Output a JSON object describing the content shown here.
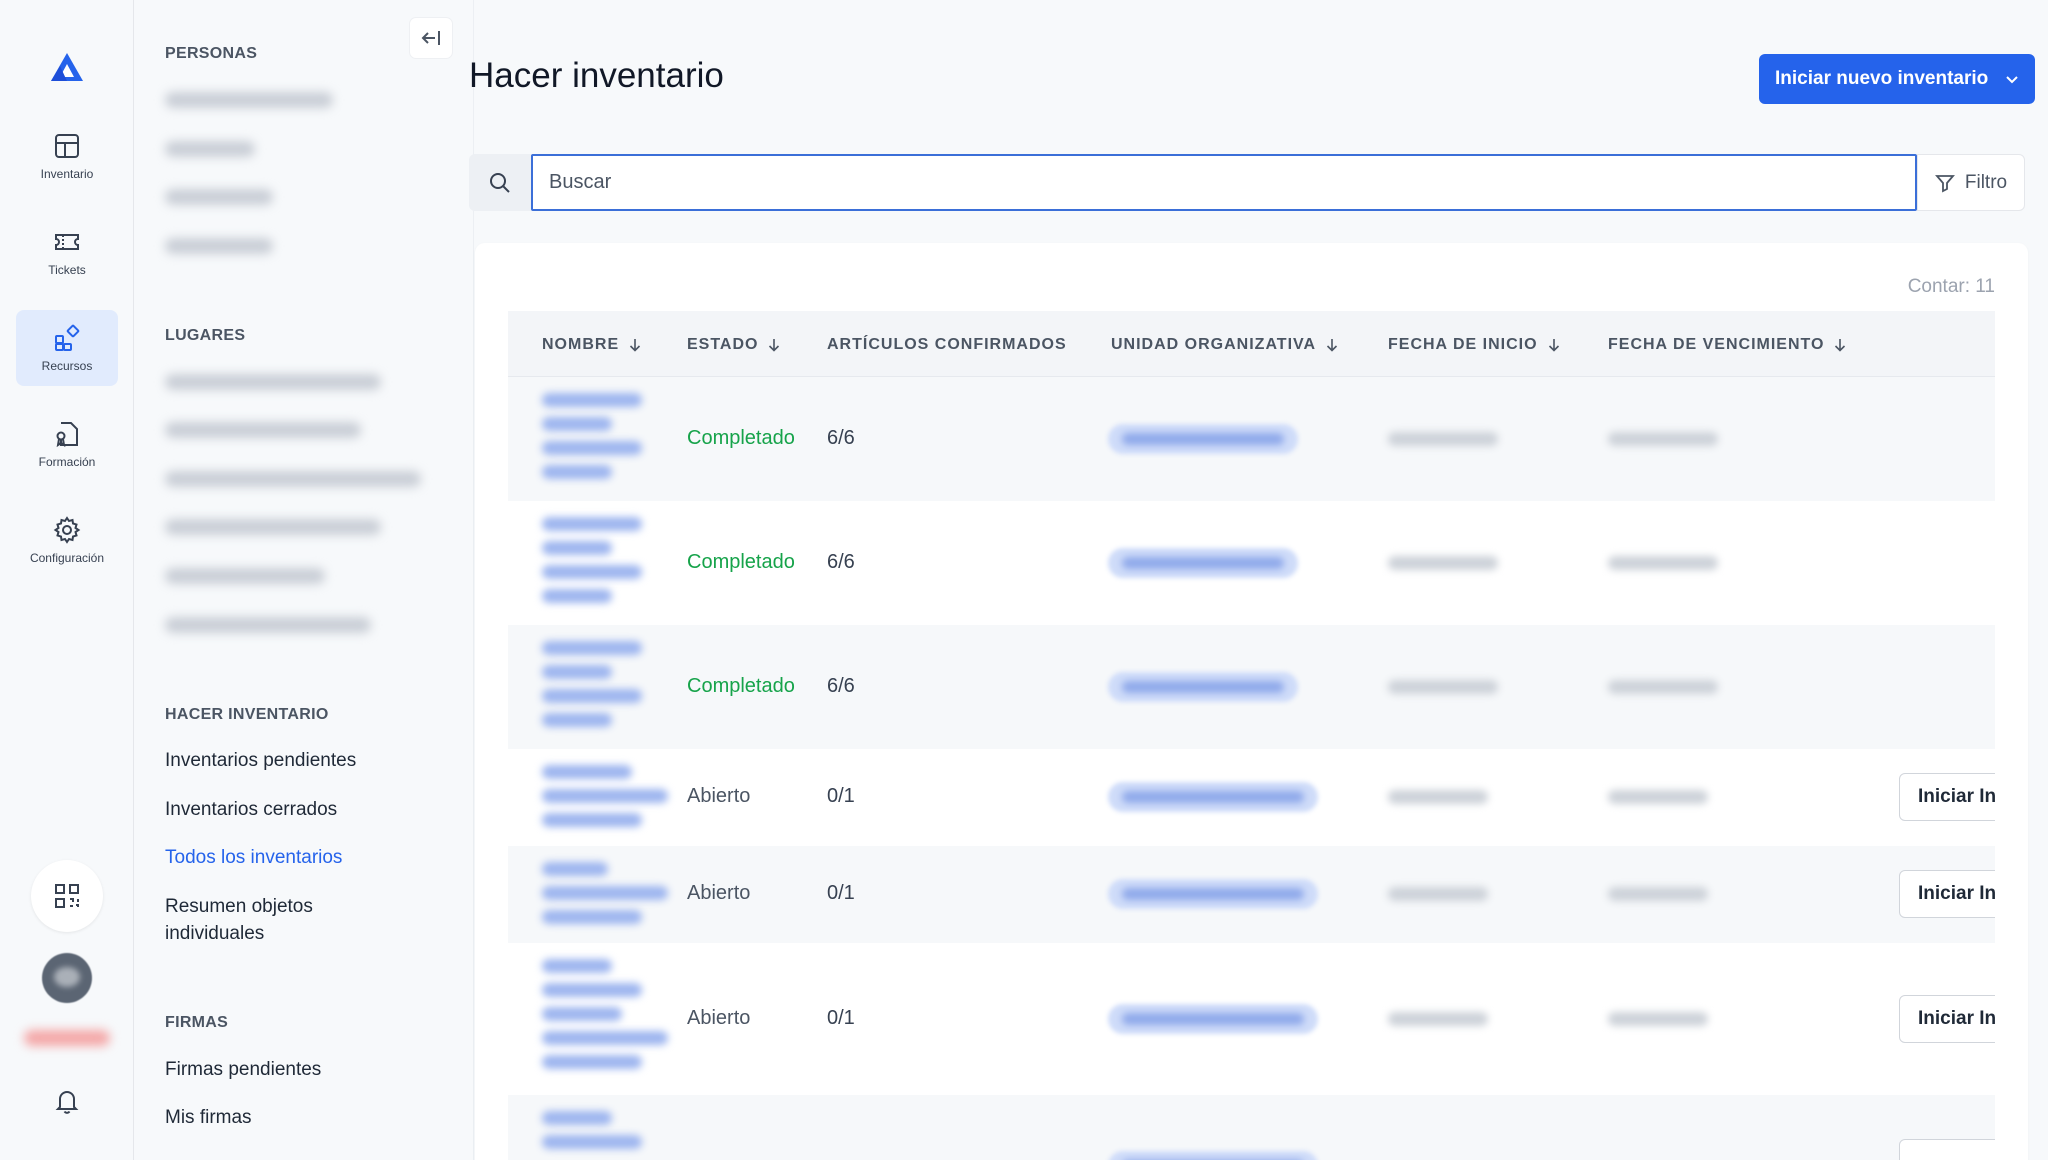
{
  "rail": {
    "items": [
      {
        "label": "Inventario",
        "icon": "table-grid-icon"
      },
      {
        "label": "Tickets",
        "icon": "ticket-icon"
      },
      {
        "label": "Recursos",
        "icon": "apps-icon",
        "active": true
      },
      {
        "label": "Formación",
        "icon": "certificate-icon"
      },
      {
        "label": "Configuración",
        "icon": "gear-icon"
      }
    ]
  },
  "sidebar": {
    "sections": {
      "personas": "PERSONAS",
      "lugares": "LUGARES",
      "hacer_inventario": "HACER INVENTARIO",
      "firmas": "FIRMAS"
    },
    "inventory_items": [
      "Inventarios pendientes",
      "Inventarios cerrados",
      "Todos los inventarios",
      "Resumen objetos",
      "individuales"
    ],
    "firmas_items": [
      "Firmas pendientes",
      "Mis firmas"
    ]
  },
  "header": {
    "title": "Hacer inventario",
    "new_button": "Iniciar nuevo inventario"
  },
  "search": {
    "placeholder": "Buscar",
    "filter_label": "Filtro"
  },
  "table": {
    "count_label": "Contar: 11",
    "columns": [
      "NOMBRE",
      "ESTADO",
      "ARTÍCULOS CONFIRMADOS",
      "UNIDAD ORGANIZATIVA",
      "FECHA DE INICIO",
      "FECHA DE VENCIMIENTO"
    ],
    "rows": [
      {
        "estado": "Completado",
        "articulos": "6/6"
      },
      {
        "estado": "Completado",
        "articulos": "6/6"
      },
      {
        "estado": "Completado",
        "articulos": "6/6"
      },
      {
        "estado": "Abierto",
        "articulos": "0/1",
        "action": "Iniciar Inventario"
      },
      {
        "estado": "Abierto",
        "articulos": "0/1",
        "action": "Iniciar Inventario"
      },
      {
        "estado": "Abierto",
        "articulos": "0/1",
        "action": "Iniciar Inventario"
      }
    ]
  },
  "colors": {
    "accent": "#2563eb",
    "status_done": "#16a34a",
    "status_open": "#4b5563"
  }
}
